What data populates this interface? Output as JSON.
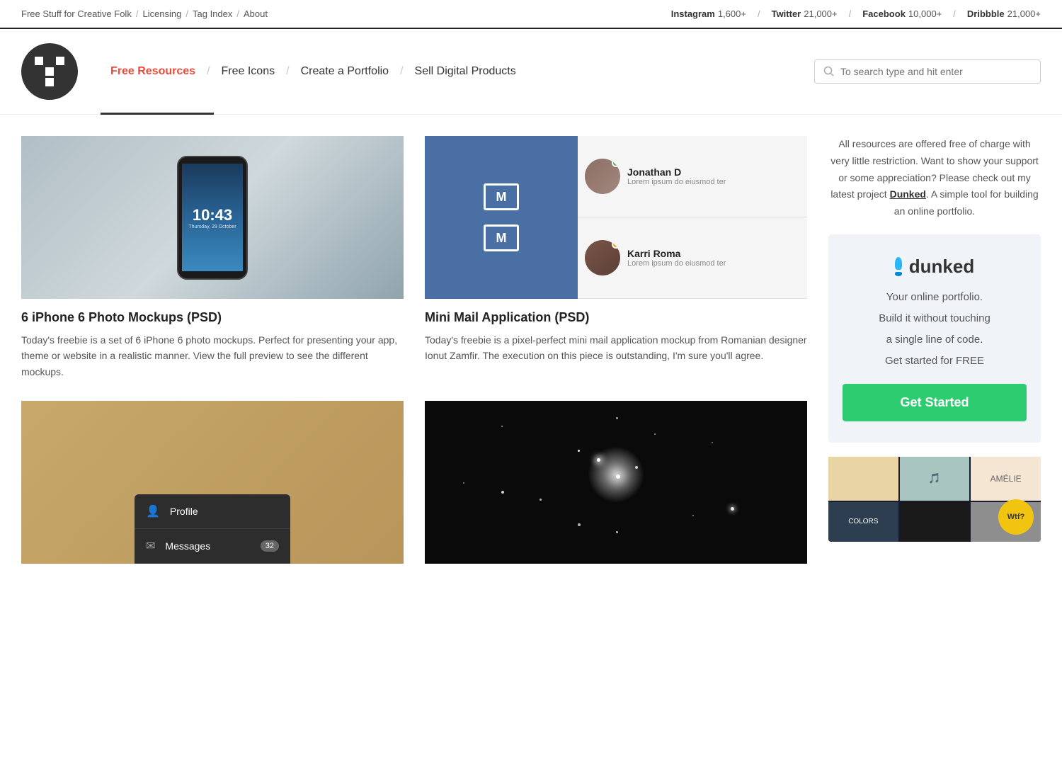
{
  "topbar": {
    "site_title": "Free Stuff for Creative Folk",
    "sep1": "/",
    "licensing": "Licensing",
    "sep2": "/",
    "tag_index": "Tag Index",
    "sep3": "/",
    "about": "About",
    "social": [
      {
        "name": "Instagram",
        "count": "1,600+"
      },
      {
        "name": "Twitter",
        "count": "21,000+"
      },
      {
        "name": "Facebook",
        "count": "10,000+"
      },
      {
        "name": "Dribbble",
        "count": "21,000+"
      }
    ]
  },
  "nav": {
    "active_link": "Free Resources",
    "links": [
      {
        "label": "Free Resources",
        "active": true
      },
      {
        "label": "Free Icons",
        "active": false
      },
      {
        "label": "Create a Portfolio",
        "active": false
      },
      {
        "label": "Sell Digital Products",
        "active": false
      }
    ],
    "search_placeholder": "To search type and hit enter"
  },
  "articles": [
    {
      "title": "6 iPhone 6 Photo Mockups (PSD)",
      "desc": "Today's freebie is a set of 6 iPhone 6 photo mockups. Perfect for presenting your app, theme or website in a realistic manner. View the full preview to see the different mockups.",
      "type": "iphone",
      "iphone_time": "10:43",
      "iphone_date": "Thursday, 29 October"
    },
    {
      "title": "Mini Mail Application (PSD)",
      "desc": "Today's freebie is a pixel-perfect mini mail application mockup from Romanian designer Ionut Zamfir. The execution on this piece is outstanding, I'm sure you'll agree.",
      "type": "mail",
      "contacts": [
        {
          "name": "Jonathan D",
          "text": "Lorem ipsum do eiusmod ter",
          "online": "green"
        },
        {
          "name": "Karri Roma",
          "text": "Lorem ipsum do eiusmod ter",
          "online": "orange"
        }
      ]
    },
    {
      "title": "",
      "desc": "",
      "type": "profile"
    },
    {
      "title": "",
      "desc": "",
      "type": "stars"
    }
  ],
  "profile_menu": [
    {
      "icon": "👤",
      "label": "Profile"
    },
    {
      "icon": "✉",
      "label": "Messages",
      "badge": "32"
    }
  ],
  "sidebar": {
    "text_part1": "All resources are offered free of charge with very little restriction. Want to show your support or some appreciation? Please check out my latest project ",
    "dunked_link": "Dunked",
    "text_part2": ". A simple tool for building an online portfolio.",
    "dunked": {
      "name": "dunked",
      "tagline1": "Your online portfolio.",
      "tagline2": "Build it without touching",
      "tagline3": "a single line of code.",
      "tagline4": "Get started for FREE",
      "cta": "Get Started"
    },
    "wtf_badge": "Wtf?"
  }
}
